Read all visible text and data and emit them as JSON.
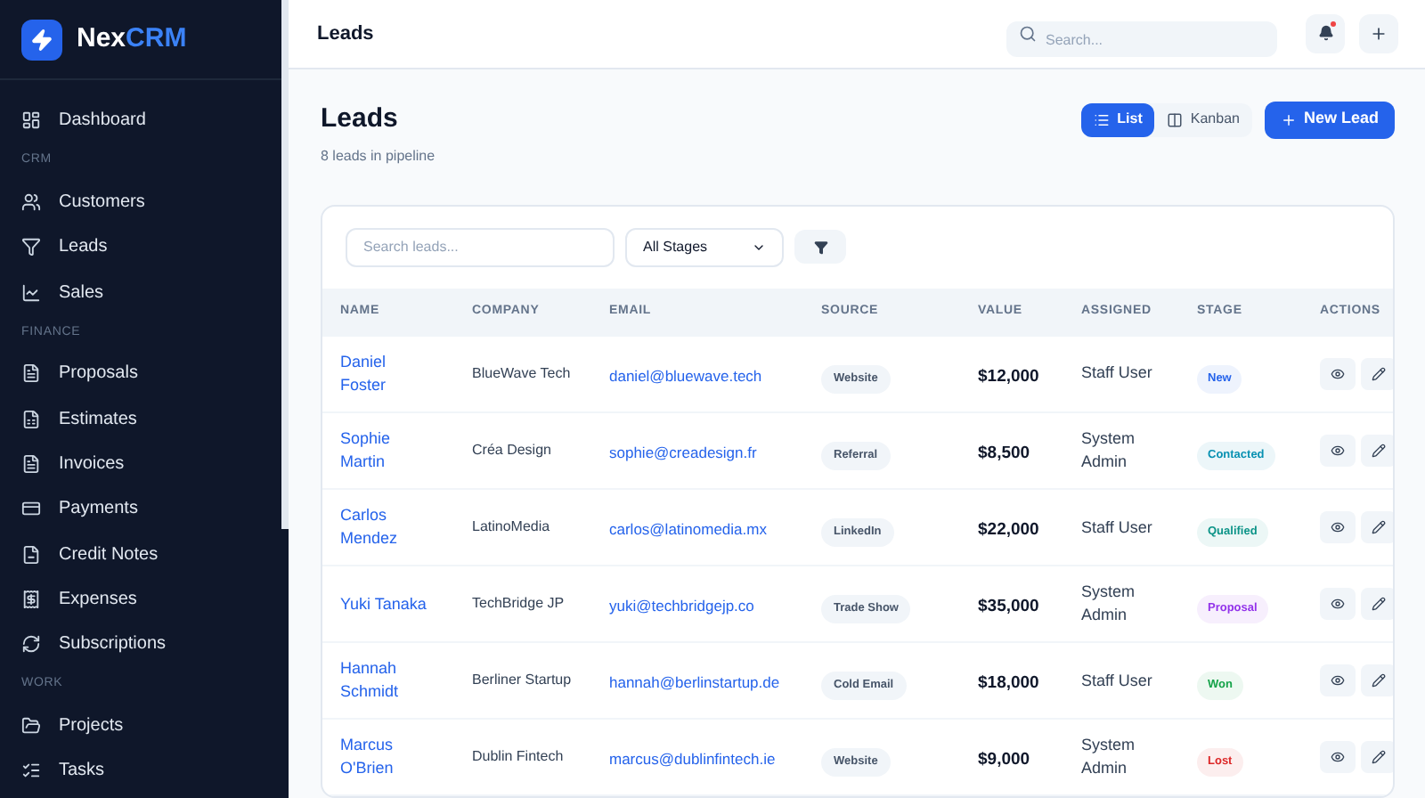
{
  "brand": {
    "name": "Nex",
    "accent": "CRM"
  },
  "sidebar": {
    "sections": [
      {
        "items": [
          {
            "label": "Dashboard"
          }
        ]
      },
      {
        "heading": "CRM",
        "items": [
          {
            "label": "Customers"
          },
          {
            "label": "Leads"
          },
          {
            "label": "Sales"
          }
        ]
      },
      {
        "heading": "FINANCE",
        "items": [
          {
            "label": "Proposals"
          },
          {
            "label": "Estimates"
          },
          {
            "label": "Invoices"
          },
          {
            "label": "Payments"
          },
          {
            "label": "Credit Notes"
          },
          {
            "label": "Expenses"
          },
          {
            "label": "Subscriptions"
          }
        ]
      },
      {
        "heading": "WORK",
        "items": [
          {
            "label": "Projects"
          },
          {
            "label": "Tasks"
          }
        ]
      }
    ]
  },
  "topbar": {
    "title": "Leads",
    "search": {
      "placeholder": "Search..."
    },
    "notification_dot": true
  },
  "page": {
    "title": "Leads",
    "subtitle": "8 leads in pipeline",
    "views": [
      {
        "label": "List",
        "selected": true
      },
      {
        "label": "Kanban",
        "selected": false
      }
    ],
    "new_button": "New Lead"
  },
  "filters": {
    "search": {
      "placeholder": "Search leads..."
    },
    "stage_select": "All Stages"
  },
  "table": {
    "columns": [
      "NAME",
      "COMPANY",
      "EMAIL",
      "SOURCE",
      "VALUE",
      "ASSIGNED",
      "STAGE",
      "ACTIONS"
    ],
    "rows": [
      {
        "name": "Daniel Foster",
        "company": "BlueWave Tech",
        "email": "daniel@bluewave.tech",
        "source": "Website",
        "value": "$12,000",
        "assigned": "Staff User",
        "stage": "New",
        "color": "#2563eb"
      },
      {
        "name": "Sophie Martin",
        "company": "Créa Design",
        "email": "sophie@creadesign.fr",
        "source": "Referral",
        "value": "$8,500",
        "assigned": "System Admin",
        "stage": "Contacted",
        "color": "#0891b2"
      },
      {
        "name": "Carlos Mendez",
        "company": "LatinoMedia",
        "email": "carlos@latinomedia.mx",
        "source": "LinkedIn",
        "value": "$22,000",
        "assigned": "Staff User",
        "stage": "Qualified",
        "color": "#0d9488"
      },
      {
        "name": "Yuki Tanaka",
        "company": "TechBridge JP",
        "email": "yuki@techbridgejp.co",
        "source": "Trade Show",
        "value": "$35,000",
        "assigned": "System Admin",
        "stage": "Proposal",
        "color": "#9333ea"
      },
      {
        "name": "Hannah Schmidt",
        "company": "Berliner Startup",
        "email": "hannah@berlinstartup.de",
        "source": "Cold Email",
        "value": "$18,000",
        "assigned": "Staff User",
        "stage": "Won",
        "color": "#16a34a"
      },
      {
        "name": "Marcus O'Brien",
        "company": "Dublin Fintech",
        "email": "marcus@dublinfintech.ie",
        "source": "Website",
        "value": "$9,000",
        "assigned": "System Admin",
        "stage": "Lost",
        "color": "#dc2626"
      }
    ]
  }
}
